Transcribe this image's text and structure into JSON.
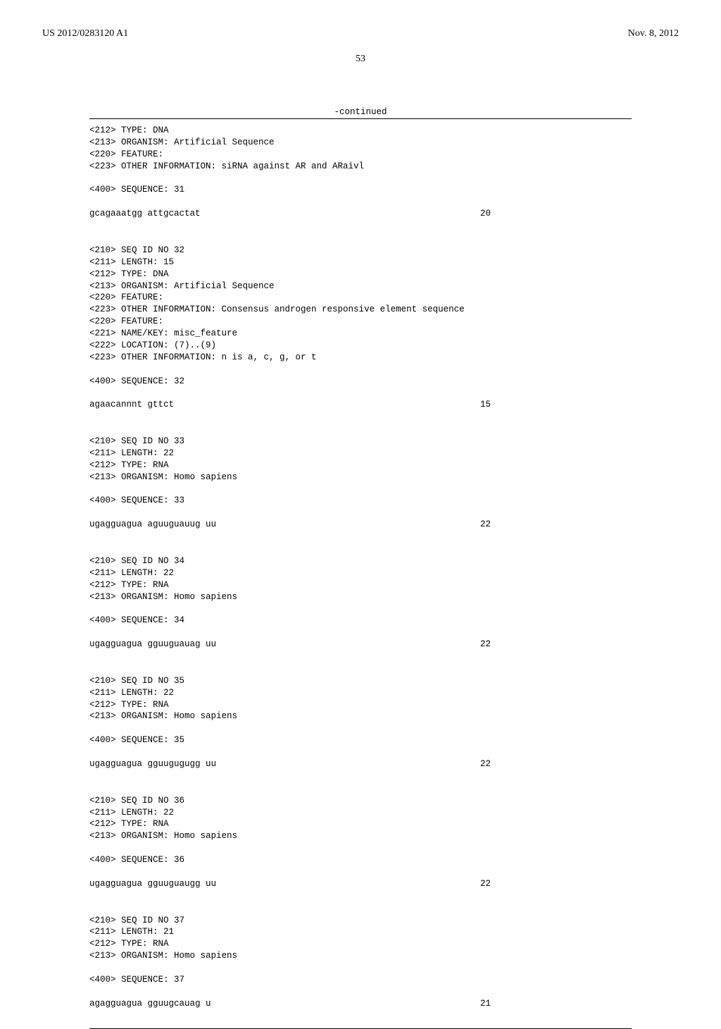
{
  "header": {
    "publication_number": "US 2012/0283120 A1",
    "publication_date": "Nov. 8, 2012"
  },
  "page_number": "53",
  "continued_label": "-continued",
  "blocks": [
    {
      "meta": [
        "<212> TYPE: DNA",
        "<213> ORGANISM: Artificial Sequence",
        "<220> FEATURE:",
        "<223> OTHER INFORMATION: siRNA against AR and ARaivl"
      ],
      "seq_header": "<400> SEQUENCE: 31",
      "sequence": "gcagaaatgg attgcactat",
      "length": "20"
    },
    {
      "meta": [
        "<210> SEQ ID NO 32",
        "<211> LENGTH: 15",
        "<212> TYPE: DNA",
        "<213> ORGANISM: Artificial Sequence",
        "<220> FEATURE:",
        "<223> OTHER INFORMATION: Consensus androgen responsive element sequence",
        "<220> FEATURE:",
        "<221> NAME/KEY: misc_feature",
        "<222> LOCATION: (7)..(9)",
        "<223> OTHER INFORMATION: n is a, c, g, or t"
      ],
      "seq_header": "<400> SEQUENCE: 32",
      "sequence": "agaacannnt gttct",
      "length": "15"
    },
    {
      "meta": [
        "<210> SEQ ID NO 33",
        "<211> LENGTH: 22",
        "<212> TYPE: RNA",
        "<213> ORGANISM: Homo sapiens"
      ],
      "seq_header": "<400> SEQUENCE: 33",
      "sequence": "ugagguagua aguuguauug uu",
      "length": "22"
    },
    {
      "meta": [
        "<210> SEQ ID NO 34",
        "<211> LENGTH: 22",
        "<212> TYPE: RNA",
        "<213> ORGANISM: Homo sapiens"
      ],
      "seq_header": "<400> SEQUENCE: 34",
      "sequence": "ugagguagua gguuguauag uu",
      "length": "22"
    },
    {
      "meta": [
        "<210> SEQ ID NO 35",
        "<211> LENGTH: 22",
        "<212> TYPE: RNA",
        "<213> ORGANISM: Homo sapiens"
      ],
      "seq_header": "<400> SEQUENCE: 35",
      "sequence": "ugagguagua gguugugugg uu",
      "length": "22"
    },
    {
      "meta": [
        "<210> SEQ ID NO 36",
        "<211> LENGTH: 22",
        "<212> TYPE: RNA",
        "<213> ORGANISM: Homo sapiens"
      ],
      "seq_header": "<400> SEQUENCE: 36",
      "sequence": "ugagguagua gguuguaugg uu",
      "length": "22"
    },
    {
      "meta": [
        "<210> SEQ ID NO 37",
        "<211> LENGTH: 21",
        "<212> TYPE: RNA",
        "<213> ORGANISM: Homo sapiens"
      ],
      "seq_header": "<400> SEQUENCE: 37",
      "sequence": "agagguagua gguugcauag u",
      "length": "21"
    }
  ]
}
